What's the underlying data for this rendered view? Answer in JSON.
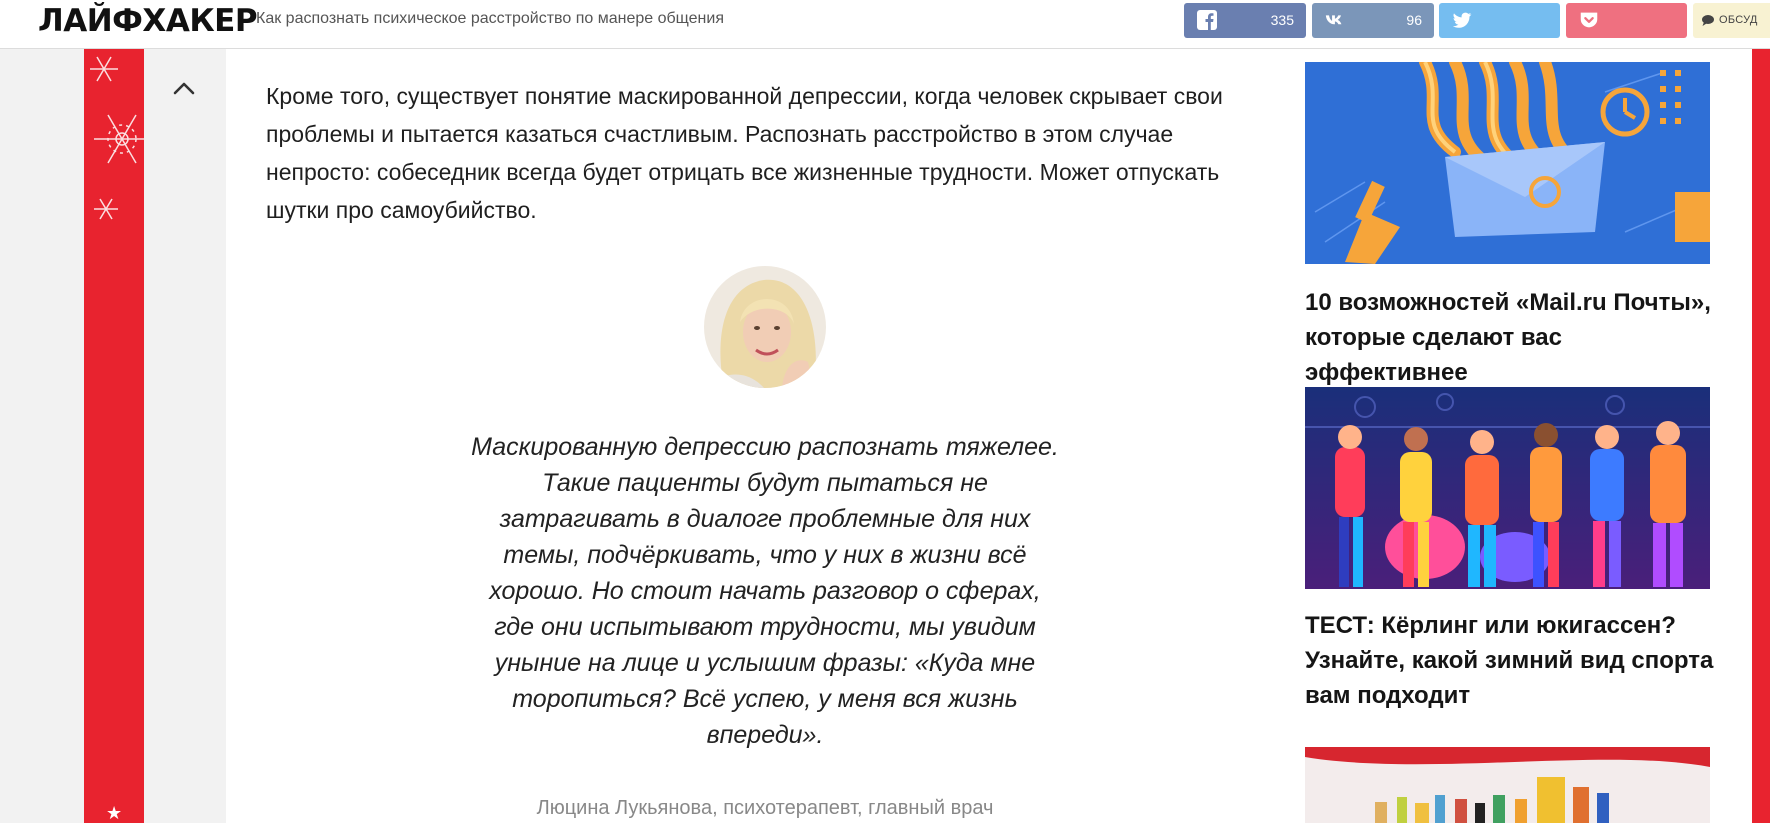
{
  "header": {
    "logo": "ЛАЙФХАКЕР",
    "article_title": "Как распознать психическое расстройство по манере общения"
  },
  "share": {
    "facebook": {
      "icon": "facebook-icon",
      "count": "335",
      "color": "#6a7fb0"
    },
    "vk": {
      "icon": "vk-icon",
      "count": "96",
      "color": "#7b96b9"
    },
    "twitter": {
      "icon": "twitter-icon",
      "color": "#75bdf0"
    },
    "pocket": {
      "icon": "pocket-icon",
      "color": "#ef7080"
    },
    "discuss": {
      "icon": "comment-icon",
      "label": "ОБСУД"
    }
  },
  "colors": {
    "accent": "#e8232f"
  },
  "article": {
    "paragraph": "Кроме того, существует понятие маскированной депрессии, когда человек скрывает свои проблемы и пытается казаться счастливым. Распознать расстройство в этом случае непросто: собеседник всегда будет отрицать все жизненные трудности. Может отпускать шутки про самоубийство.",
    "quote": "Маскированную депрессию распознать тяжелее. Такие пациенты будут пытаться не затрагивать в диалоге проблемные для них темы, подчёркивать, что у них в жизни всё хорошо. Но стоит начать разговор о сферах, где они испытывают трудности, мы увидим уныние на лице и услышим фразы: «Куда мне торопиться? Всё успею, у меня вся жизнь впереди».",
    "quote_author": "Люцина Лукьянова, психотерапевт, главный врач"
  },
  "sidebar": {
    "cards": [
      {
        "title": "10 возможностей «Mail.ru Почты», которые сделают вас эффективнее"
      },
      {
        "title": "ТЕСТ: Кёрлинг или юкигассен? Узнайте, какой зимний вид спорта вам подходит"
      }
    ]
  }
}
